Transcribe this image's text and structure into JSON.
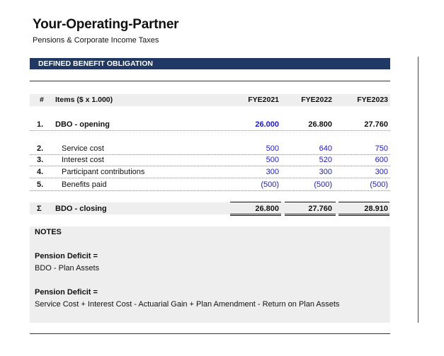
{
  "header": {
    "title": "Your-Operating-Partner",
    "subtitle": "Pensions & Corporate Income Taxes"
  },
  "section_label": "DEFINED BENEFIT OBLIGATION",
  "table": {
    "columns": {
      "num": "#",
      "item": "Items ($ x 1.000)",
      "y1": "FYE2021",
      "y2": "FYE2022",
      "y3": "FYE2023"
    },
    "opening": {
      "num": "1.",
      "label": "DBO - opening",
      "values": [
        "26.000",
        "26.800",
        "27.760"
      ]
    },
    "components": [
      {
        "num": "2.",
        "label": "Service cost",
        "values": [
          "500",
          "640",
          "750"
        ]
      },
      {
        "num": "3.",
        "label": "Interest cost",
        "values": [
          "500",
          "520",
          "600"
        ]
      },
      {
        "num": "4.",
        "label": "Participant contributions",
        "values": [
          "300",
          "300",
          "300"
        ]
      },
      {
        "num": "5.",
        "label": "Benefits paid",
        "values": [
          "(500)",
          "(500)",
          "(500)"
        ]
      }
    ],
    "closing": {
      "symbol": "Σ",
      "label": "BDO - closing",
      "values": [
        "26.800",
        "27.760",
        "28.910"
      ]
    }
  },
  "notes": {
    "heading": "NOTES",
    "items": [
      {
        "title": "Pension Deficit =",
        "text": "BDO - Plan Assets"
      },
      {
        "title": "Pension Deficit =",
        "text": "Service Cost + Interest Cost - Actuarial Gain + Plan Amendment - Return on Plan Assets"
      }
    ]
  },
  "colors": {
    "section_bar": "#1f3864",
    "input_blue": "#1a1acc",
    "band_gray": "#eeeeee"
  }
}
